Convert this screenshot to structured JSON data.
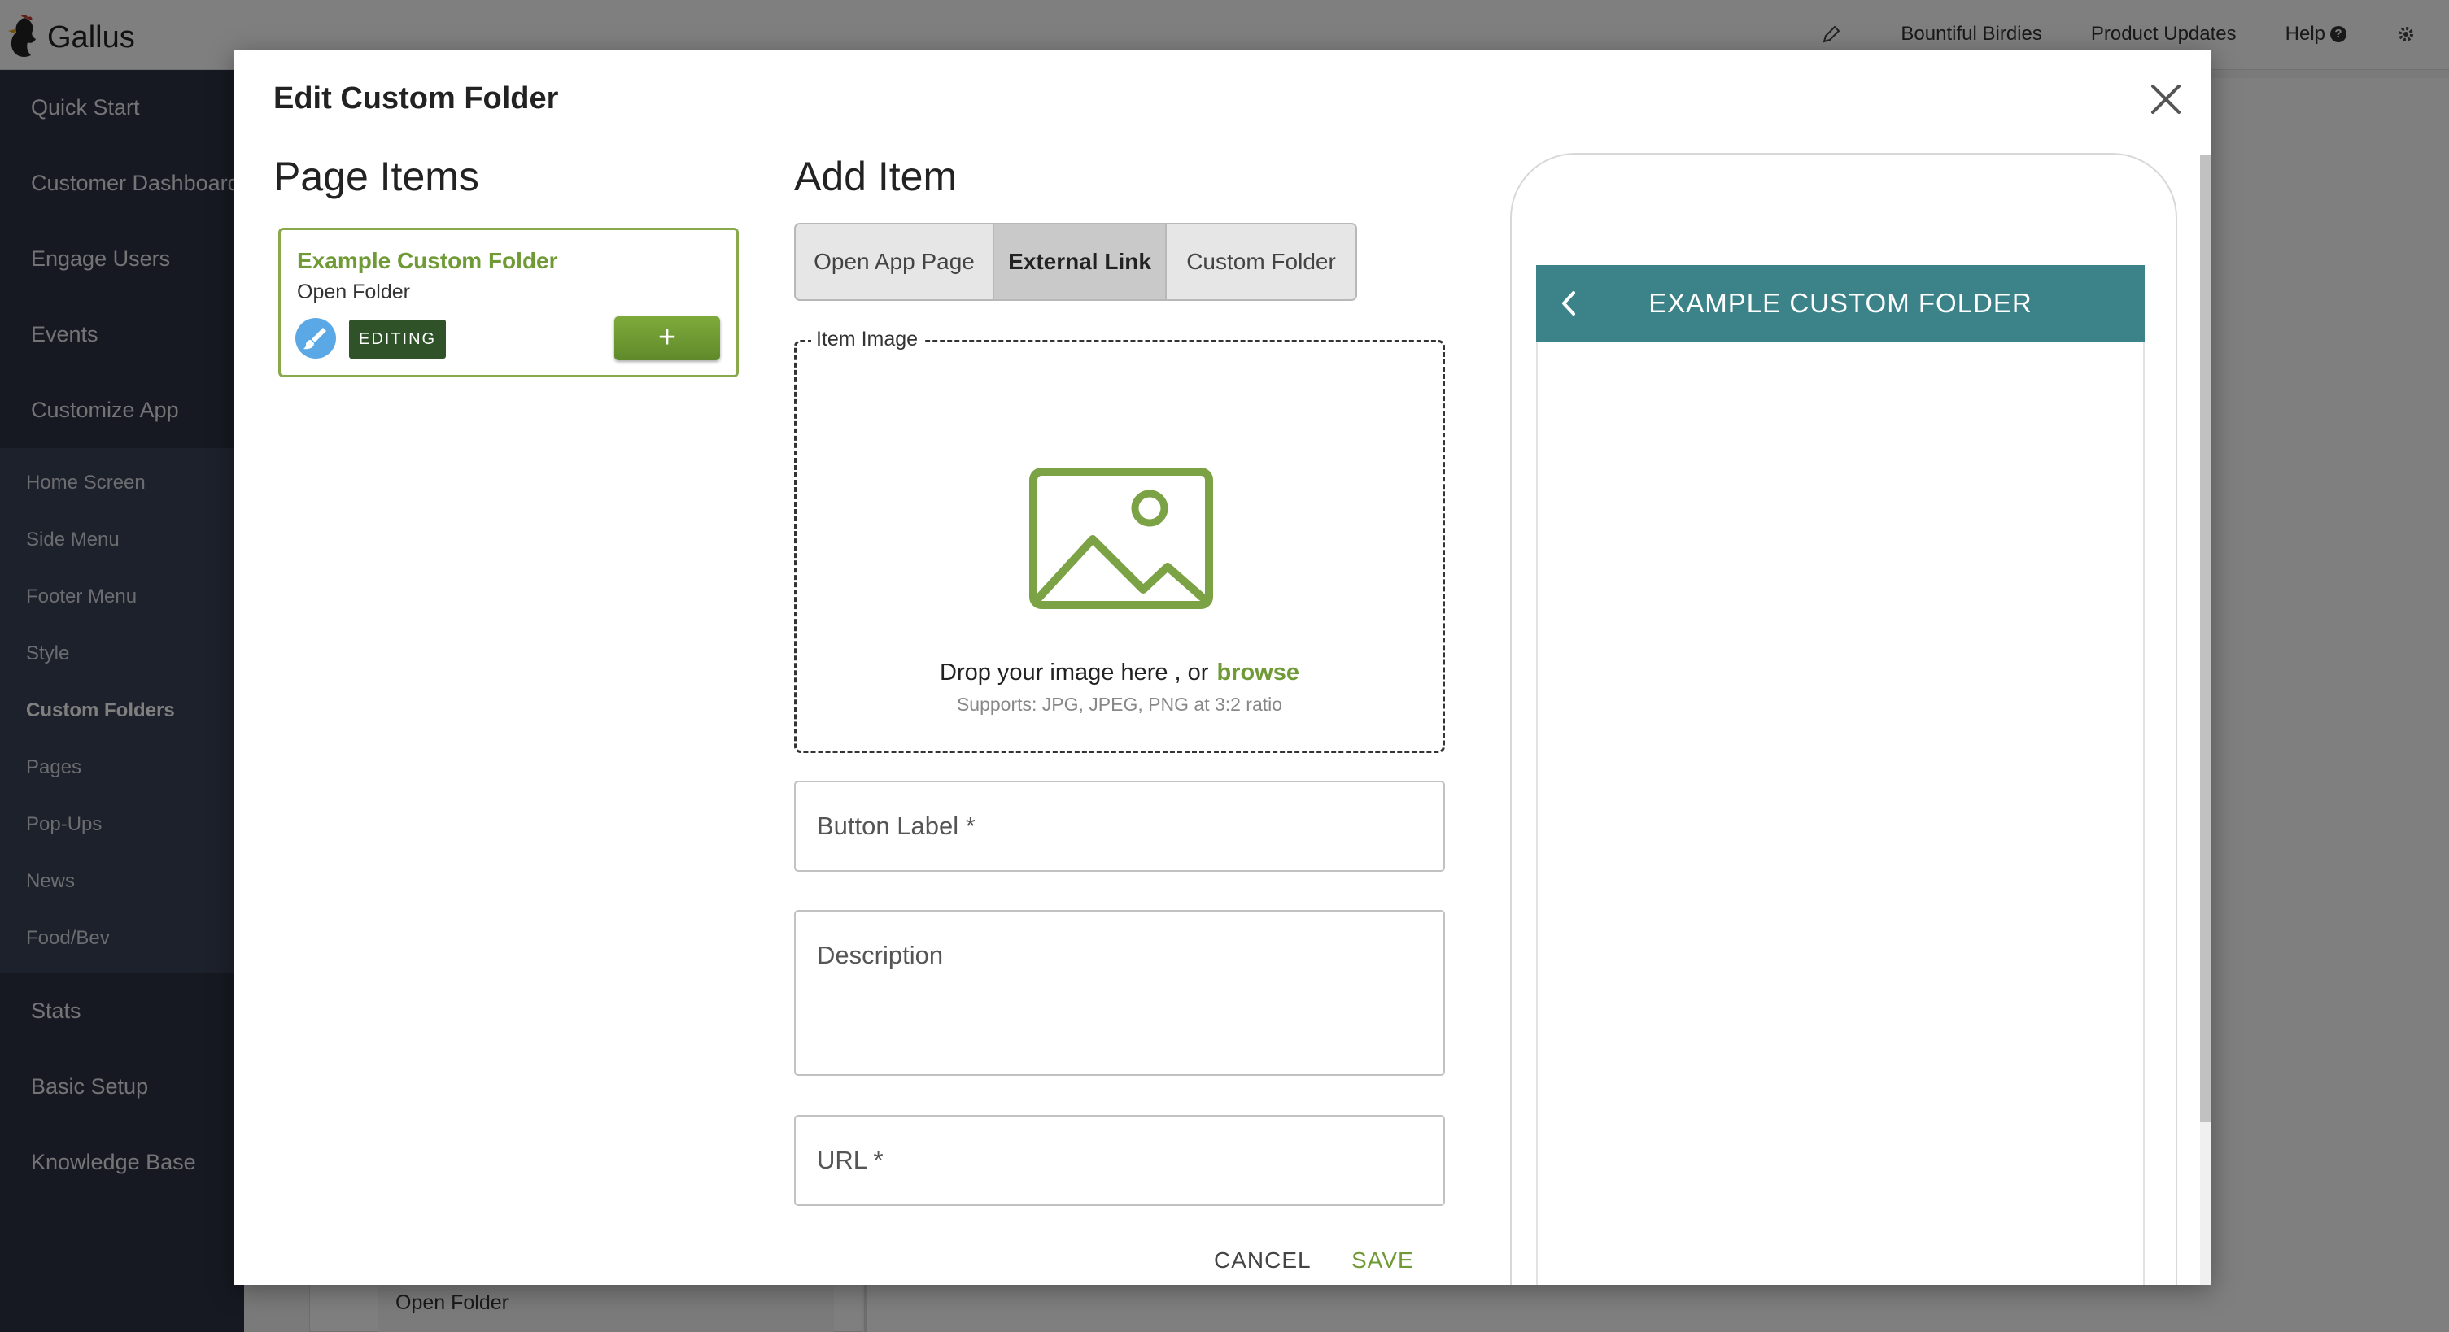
{
  "app": {
    "name": "Gallus",
    "topnav": {
      "account": "Bountiful Birdies",
      "updates": "Product Updates",
      "help": "Help",
      "help_badge": "?"
    }
  },
  "sidebar": {
    "main_items_top": [
      "Quick Start",
      "Customer Dashboard",
      "Engage Users",
      "Events",
      "Customize App"
    ],
    "sub_items": [
      "Home Screen",
      "Side Menu",
      "Footer Menu",
      "Style",
      "Custom Folders",
      "Pages",
      "Pop-Ups",
      "News",
      "Food/Bev"
    ],
    "active_sub_item": "Custom Folders",
    "main_items_bottom": [
      "Stats",
      "Basic Setup",
      "Knowledge Base"
    ]
  },
  "background": {
    "card_subtitle": "Open Folder"
  },
  "modal": {
    "title": "Edit Custom Folder",
    "page_items": {
      "heading": "Page Items",
      "item": {
        "title": "Example Custom Folder",
        "subtitle": "Open Folder",
        "badge": "EDITING",
        "add_label": "+"
      }
    },
    "add_item": {
      "heading": "Add Item",
      "tabs": [
        "Open App Page",
        "External Link",
        "Custom Folder"
      ],
      "active_tab": "External Link",
      "image": {
        "legend": "Item Image",
        "drop_text": "Drop your image here , or",
        "browse": "browse",
        "hint": "Supports: JPG, JPEG, PNG at 3:2 ratio"
      },
      "fields": {
        "button_label_placeholder": "Button Label *",
        "description_placeholder": "Description",
        "url_placeholder": "URL *"
      },
      "cancel": "CANCEL",
      "save": "SAVE"
    },
    "preview": {
      "header_title": "EXAMPLE CUSTOM FOLDER"
    }
  },
  "colors": {
    "accent_green": "#6f9a36",
    "badge_dark_green": "#2f5229",
    "preview_header": "#3b8389",
    "sidebar_bg": "#2d3342"
  }
}
